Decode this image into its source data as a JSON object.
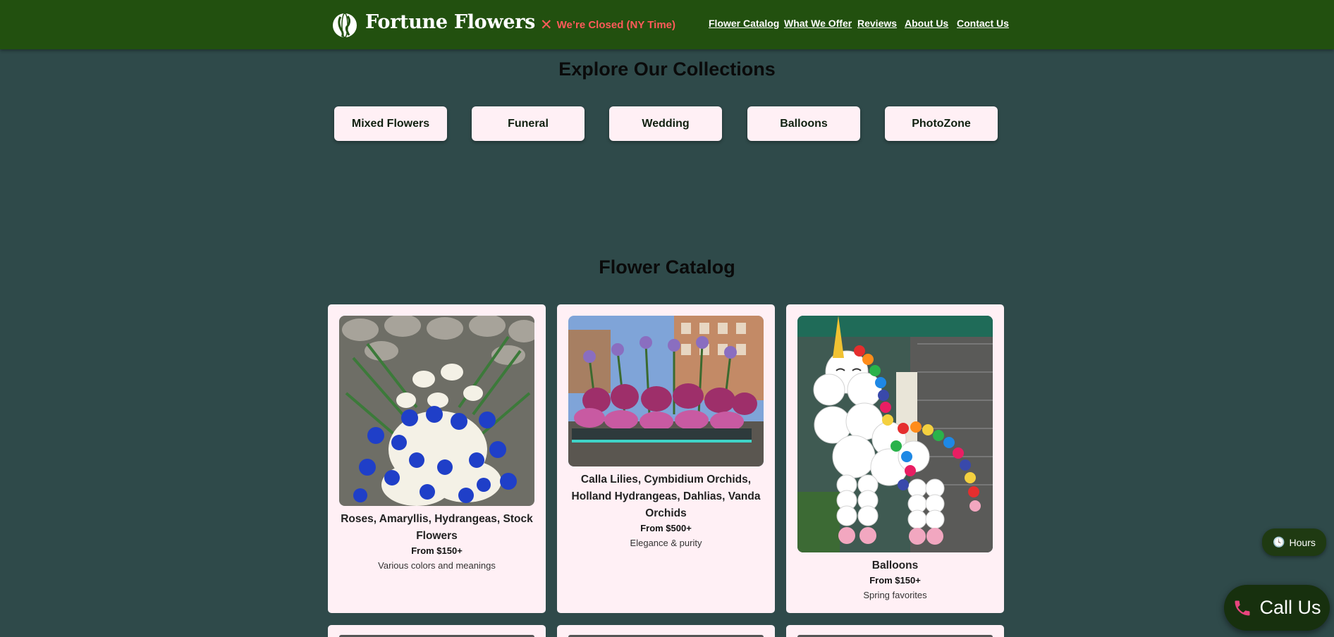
{
  "header": {
    "brand": "Fortune Flowers",
    "status": "We’re Closed (NY Time)",
    "nav": [
      "Flower Catalog",
      "What We Offer",
      "Reviews",
      "About Us",
      "Contact Us"
    ]
  },
  "collections": {
    "title": "Explore Our Collections",
    "items": [
      "Mixed Flowers",
      "Funeral",
      "Wedding",
      "Balloons",
      "PhotoZone"
    ]
  },
  "catalog": {
    "title": "Flower Catalog",
    "cards": [
      {
        "title": "Roses, Amaryllis, Hydrangeas, Stock Flowers",
        "price": "From $150+",
        "desc": "Various colors and meanings"
      },
      {
        "title": "Calla Lilies, Cymbidium Orchids, Holland Hydrangeas, Dahlias, Vanda Orchids",
        "price": "From $500+",
        "desc": "Elegance & purity"
      },
      {
        "title": "Balloons",
        "price": "From $150+",
        "desc": "Spring favorites"
      }
    ]
  },
  "floating": {
    "hours": "Hours",
    "call": "Call Us"
  },
  "colors": {
    "header_bg": "#22500f",
    "page_bg": "#2f4a4a",
    "card_bg": "#fff0f5",
    "closed_red": "#ff5a5a"
  }
}
